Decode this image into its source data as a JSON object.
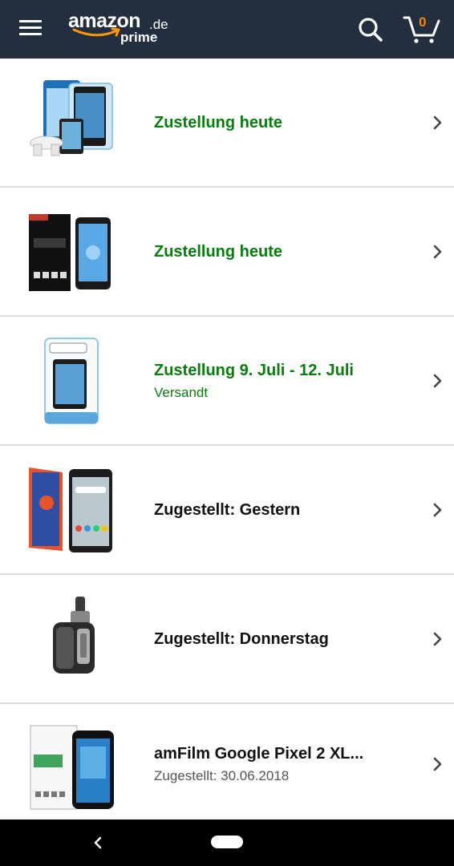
{
  "header": {
    "logo_word": "amazon",
    "logo_tld": ".de",
    "logo_sub": "prime",
    "cart_count": "0",
    "menu_icon": "hamburger-menu-icon",
    "search_icon": "search-icon",
    "cart_icon": "cart-icon"
  },
  "colors": {
    "header_bg": "#232f3e",
    "delivery_green": "#067d0c",
    "cart_orange": "#f08804",
    "smile_orange": "#ff9900"
  },
  "orders": [
    {
      "status": "Zustellung heute",
      "sub": "",
      "thumb": "screen-protector-kit-thumbnail"
    },
    {
      "status": "Zustellung heute",
      "sub": "",
      "thumb": "2-pack-screen-protector-thumbnail"
    },
    {
      "status": "Zustellung 9. Juli - 12. Juli",
      "sub": "Versandt",
      "thumb": "moodie-tempered-glass-thumbnail"
    },
    {
      "status": "Zugestellt: Gestern",
      "sub": "",
      "thumb": "skinomi-screen-protector-thumbnail"
    },
    {
      "status": "Zugestellt: Donnerstag",
      "sub": "",
      "thumb": "vaporizer-device-thumbnail"
    },
    {
      "status": "amFilm Google Pixel 2 XL...",
      "sub": "Zugestellt: 30.06.2018",
      "thumb": "amfilm-glass-thumbnail"
    }
  ]
}
